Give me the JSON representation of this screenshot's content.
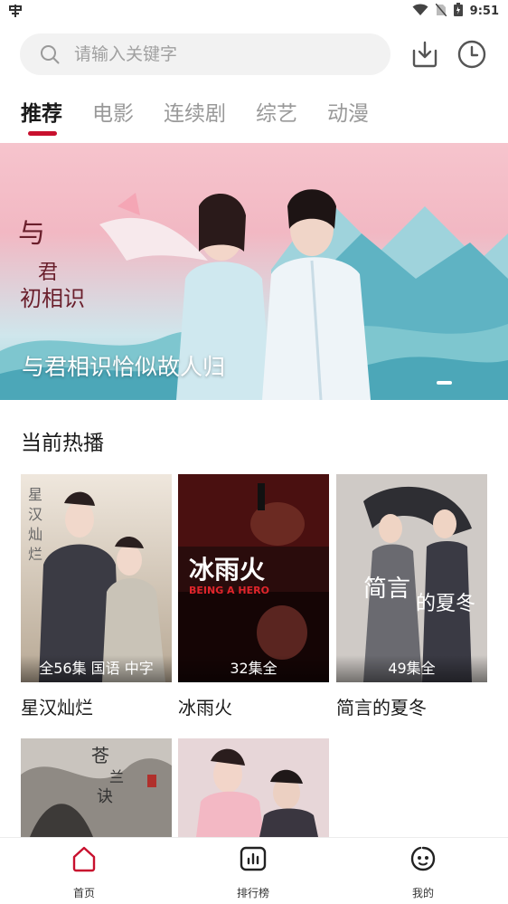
{
  "status_bar": {
    "left_icon": "app-notification-icon",
    "time": "9:51",
    "icons": [
      "wifi-icon",
      "no-sim-icon",
      "battery-icon"
    ]
  },
  "search": {
    "placeholder": "请输入关键字"
  },
  "header_actions": [
    "download-icon",
    "history-clock-icon"
  ],
  "tabs": [
    {
      "label": "推荐",
      "active": true
    },
    {
      "label": "电影",
      "active": false
    },
    {
      "label": "连续剧",
      "active": false
    },
    {
      "label": "综艺",
      "active": false
    },
    {
      "label": "动漫",
      "active": false
    }
  ],
  "banner": {
    "title": "与君相识恰似故人归",
    "logo_text": "与君初相识"
  },
  "section": {
    "title": "当前热播"
  },
  "cards": [
    {
      "title": "星汉灿烂",
      "badge": "全56集 国语 中字",
      "poster_text": "星汉灿烂"
    },
    {
      "title": "冰雨火",
      "badge": "32集全",
      "poster_text": "冰雨火",
      "poster_subtext": "BEING A HERO"
    },
    {
      "title": "简言的夏冬",
      "badge": "49集全",
      "poster_text": "简言的夏冬"
    },
    {
      "title": "",
      "badge": "",
      "poster_text": "苍兰诀"
    },
    {
      "title": "",
      "badge": "",
      "poster_text": ""
    }
  ],
  "bottom_nav": [
    {
      "label": "首页",
      "icon": "home-icon",
      "active": true
    },
    {
      "label": "排行榜",
      "icon": "chart-icon",
      "active": false
    },
    {
      "label": "我的",
      "icon": "face-icon",
      "active": false
    }
  ],
  "colors": {
    "accent": "#c8102e",
    "tab_inactive": "#999999",
    "search_bg": "#f2f2f2"
  }
}
